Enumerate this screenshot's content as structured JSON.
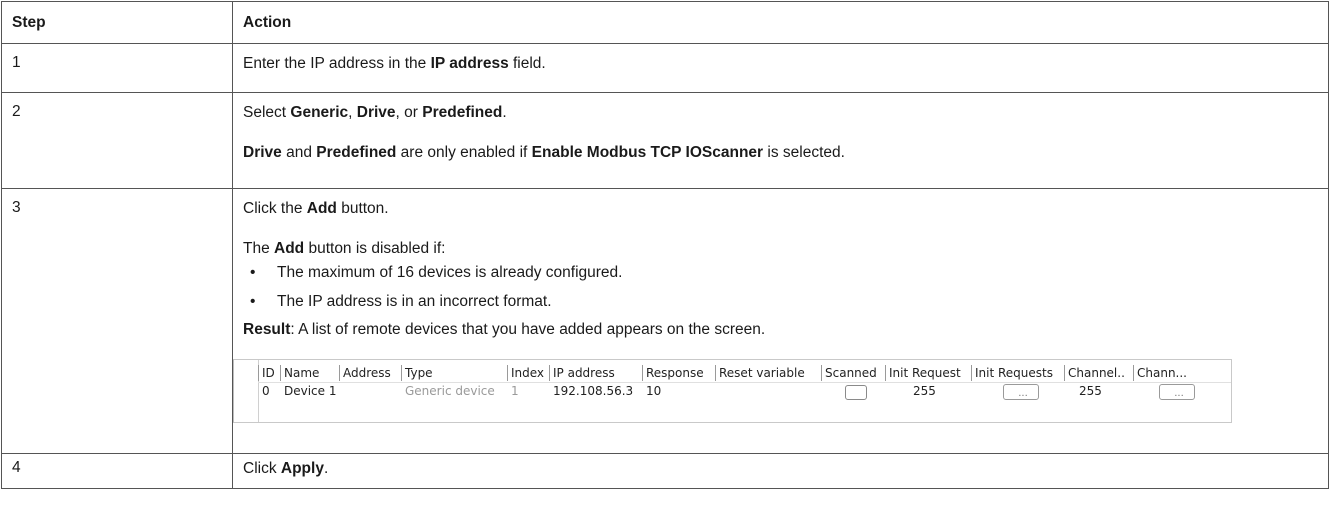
{
  "headers": {
    "step": "Step",
    "action": "Action"
  },
  "rows": [
    {
      "step": "1",
      "pre": "Enter the IP address in the ",
      "bold": "IP address",
      "post": " field."
    },
    {
      "step": "2",
      "line1": {
        "a": "Select ",
        "b1": "Generic",
        "c": ", ",
        "b2": "Drive",
        "d": ", or ",
        "b3": "Predefined",
        "e": "."
      },
      "line2": {
        "b1": "Drive",
        "a": " and ",
        "b2": "Predefined",
        "c": " are only enabled if ",
        "b3": "Enable Modbus TCP IOScanner",
        "d": " is selected."
      }
    },
    {
      "step": "3",
      "line1": {
        "a": "Click the ",
        "b": "Add",
        "c": " button."
      },
      "line2": {
        "a": "The ",
        "b": "Add",
        "c": " button is disabled if:"
      },
      "bullets": [
        "The maximum of 16 devices is already configured.",
        "The IP address is in an incorrect format."
      ],
      "result": {
        "b": "Result",
        "a": ": A list of remote devices that you have added appears on the screen."
      },
      "grid": {
        "columns": [
          "ID",
          "Name",
          "Address",
          "Type",
          "Index",
          "IP address",
          "Response",
          "Reset variable",
          "Scanned",
          "Init Request",
          "Init Requests",
          "Channel..",
          "Chann..."
        ],
        "row": {
          "id": "0",
          "name": "Device 1",
          "address": "",
          "type": "Generic device",
          "index": "1",
          "ip": "192.108.56.3",
          "response": "10",
          "reset": "",
          "scanned": false,
          "init_request": "255",
          "init_requests_btn": "...",
          "channel": "255",
          "chann_btn": "..."
        }
      }
    },
    {
      "step": "4",
      "pre": "Click ",
      "bold": "Apply",
      "post": "."
    }
  ]
}
